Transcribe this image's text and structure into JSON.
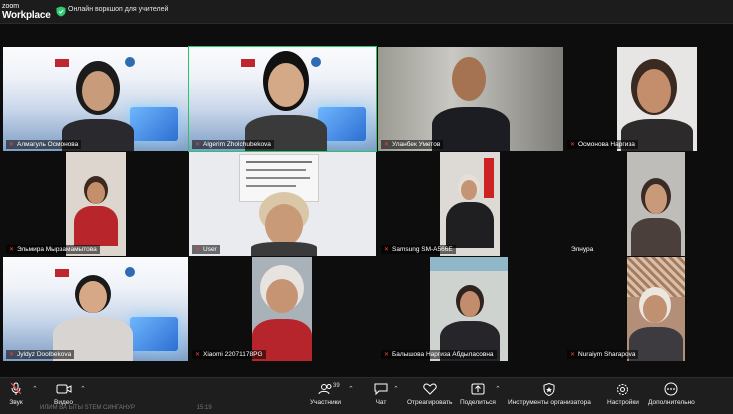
{
  "app": {
    "logo_line1": "zoom",
    "logo_line2": "Workplace"
  },
  "meeting": {
    "title": "Онлайн воркшоп для учителей"
  },
  "participants": [
    {
      "name": "Алмагуль Осмонова",
      "muted": true
    },
    {
      "name": "Algerim Zholchubekova",
      "muted": true,
      "active_speaker": true
    },
    {
      "name": "Уланбек Уметов",
      "muted": true
    },
    {
      "name": "Осмонова Наргиза",
      "muted": true
    },
    {
      "name": "Эльмира Мырзамамытова",
      "muted": true
    },
    {
      "name": "User",
      "muted": true
    },
    {
      "name": "Samsung SM-A566E",
      "muted": true
    },
    {
      "name": "Элнура",
      "muted": false
    },
    {
      "name": "Jyldyz Doolbekova",
      "muted": true
    },
    {
      "name": "Xiaomi 22071178PG",
      "muted": true
    },
    {
      "name": "Балышова Наргиза Абдыласовна",
      "muted": true
    },
    {
      "name": "Nuraiym Sharapova",
      "muted": true
    }
  ],
  "toolbar": {
    "audio": "Звук",
    "video": "Видео",
    "participants": "Участники",
    "participants_count": "39",
    "chat": "Чат",
    "react": "Отреагировать",
    "share": "Поделиться",
    "host_tools": "Инструменты организатора",
    "settings": "Настройки",
    "more": "Дополнительно"
  },
  "bottom_strip": {
    "text": "ИЛИМ ВА ЫТЫ STEM СИНГАНУР",
    "time": "15:19"
  },
  "icons": [
    "security-icon",
    "mic-muted-icon",
    "video-icon",
    "participants-icon",
    "chat-icon",
    "react-icon",
    "share-icon",
    "host-tools-icon",
    "settings-icon",
    "more-icon"
  ],
  "colors": {
    "active_border": "#27c468",
    "muted_icon": "#ff3b3b",
    "toolbar_bg": "#1e1e1e"
  }
}
